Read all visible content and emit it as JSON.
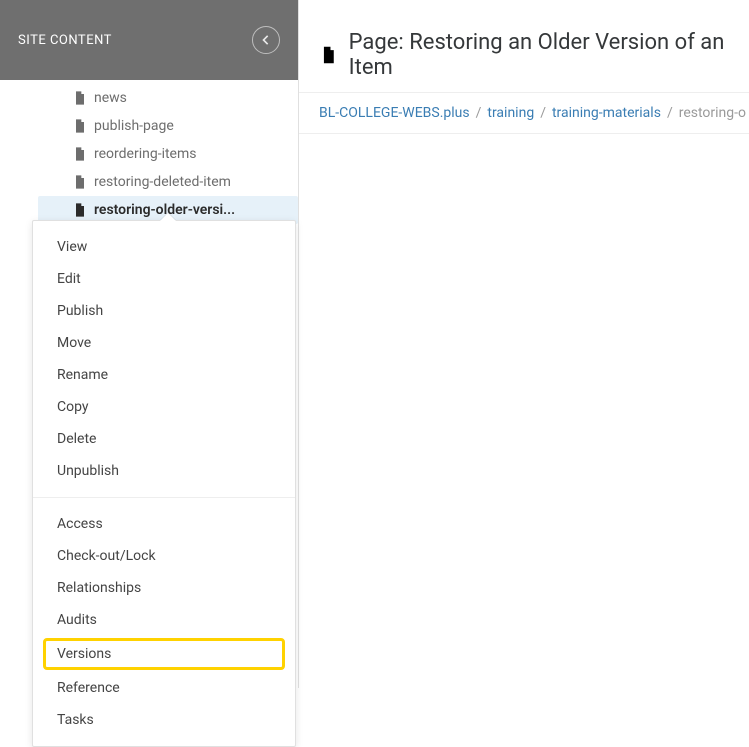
{
  "sidebar": {
    "title": "SITE CONTENT",
    "items": [
      {
        "label": "news",
        "selected": false
      },
      {
        "label": "publish-page",
        "selected": false
      },
      {
        "label": "reordering-items",
        "selected": false
      },
      {
        "label": "restoring-deleted-item",
        "selected": false
      },
      {
        "label": "restoring-older-versi...",
        "selected": true
      }
    ]
  },
  "context_menu": {
    "group1": [
      "View",
      "Edit",
      "Publish",
      "Move",
      "Rename",
      "Copy",
      "Delete",
      "Unpublish"
    ],
    "group2": [
      "Access",
      "Check-out/Lock",
      "Relationships",
      "Audits",
      "Versions",
      "Reference",
      "Tasks"
    ],
    "highlighted": "Versions"
  },
  "page": {
    "title_prefix": "Page: ",
    "title": "Restoring an Older Version of an Item"
  },
  "breadcrumb": {
    "items": [
      "BL-COLLEGE-WEBS.plus",
      "training",
      "training-materials"
    ],
    "current": "restoring-o"
  }
}
